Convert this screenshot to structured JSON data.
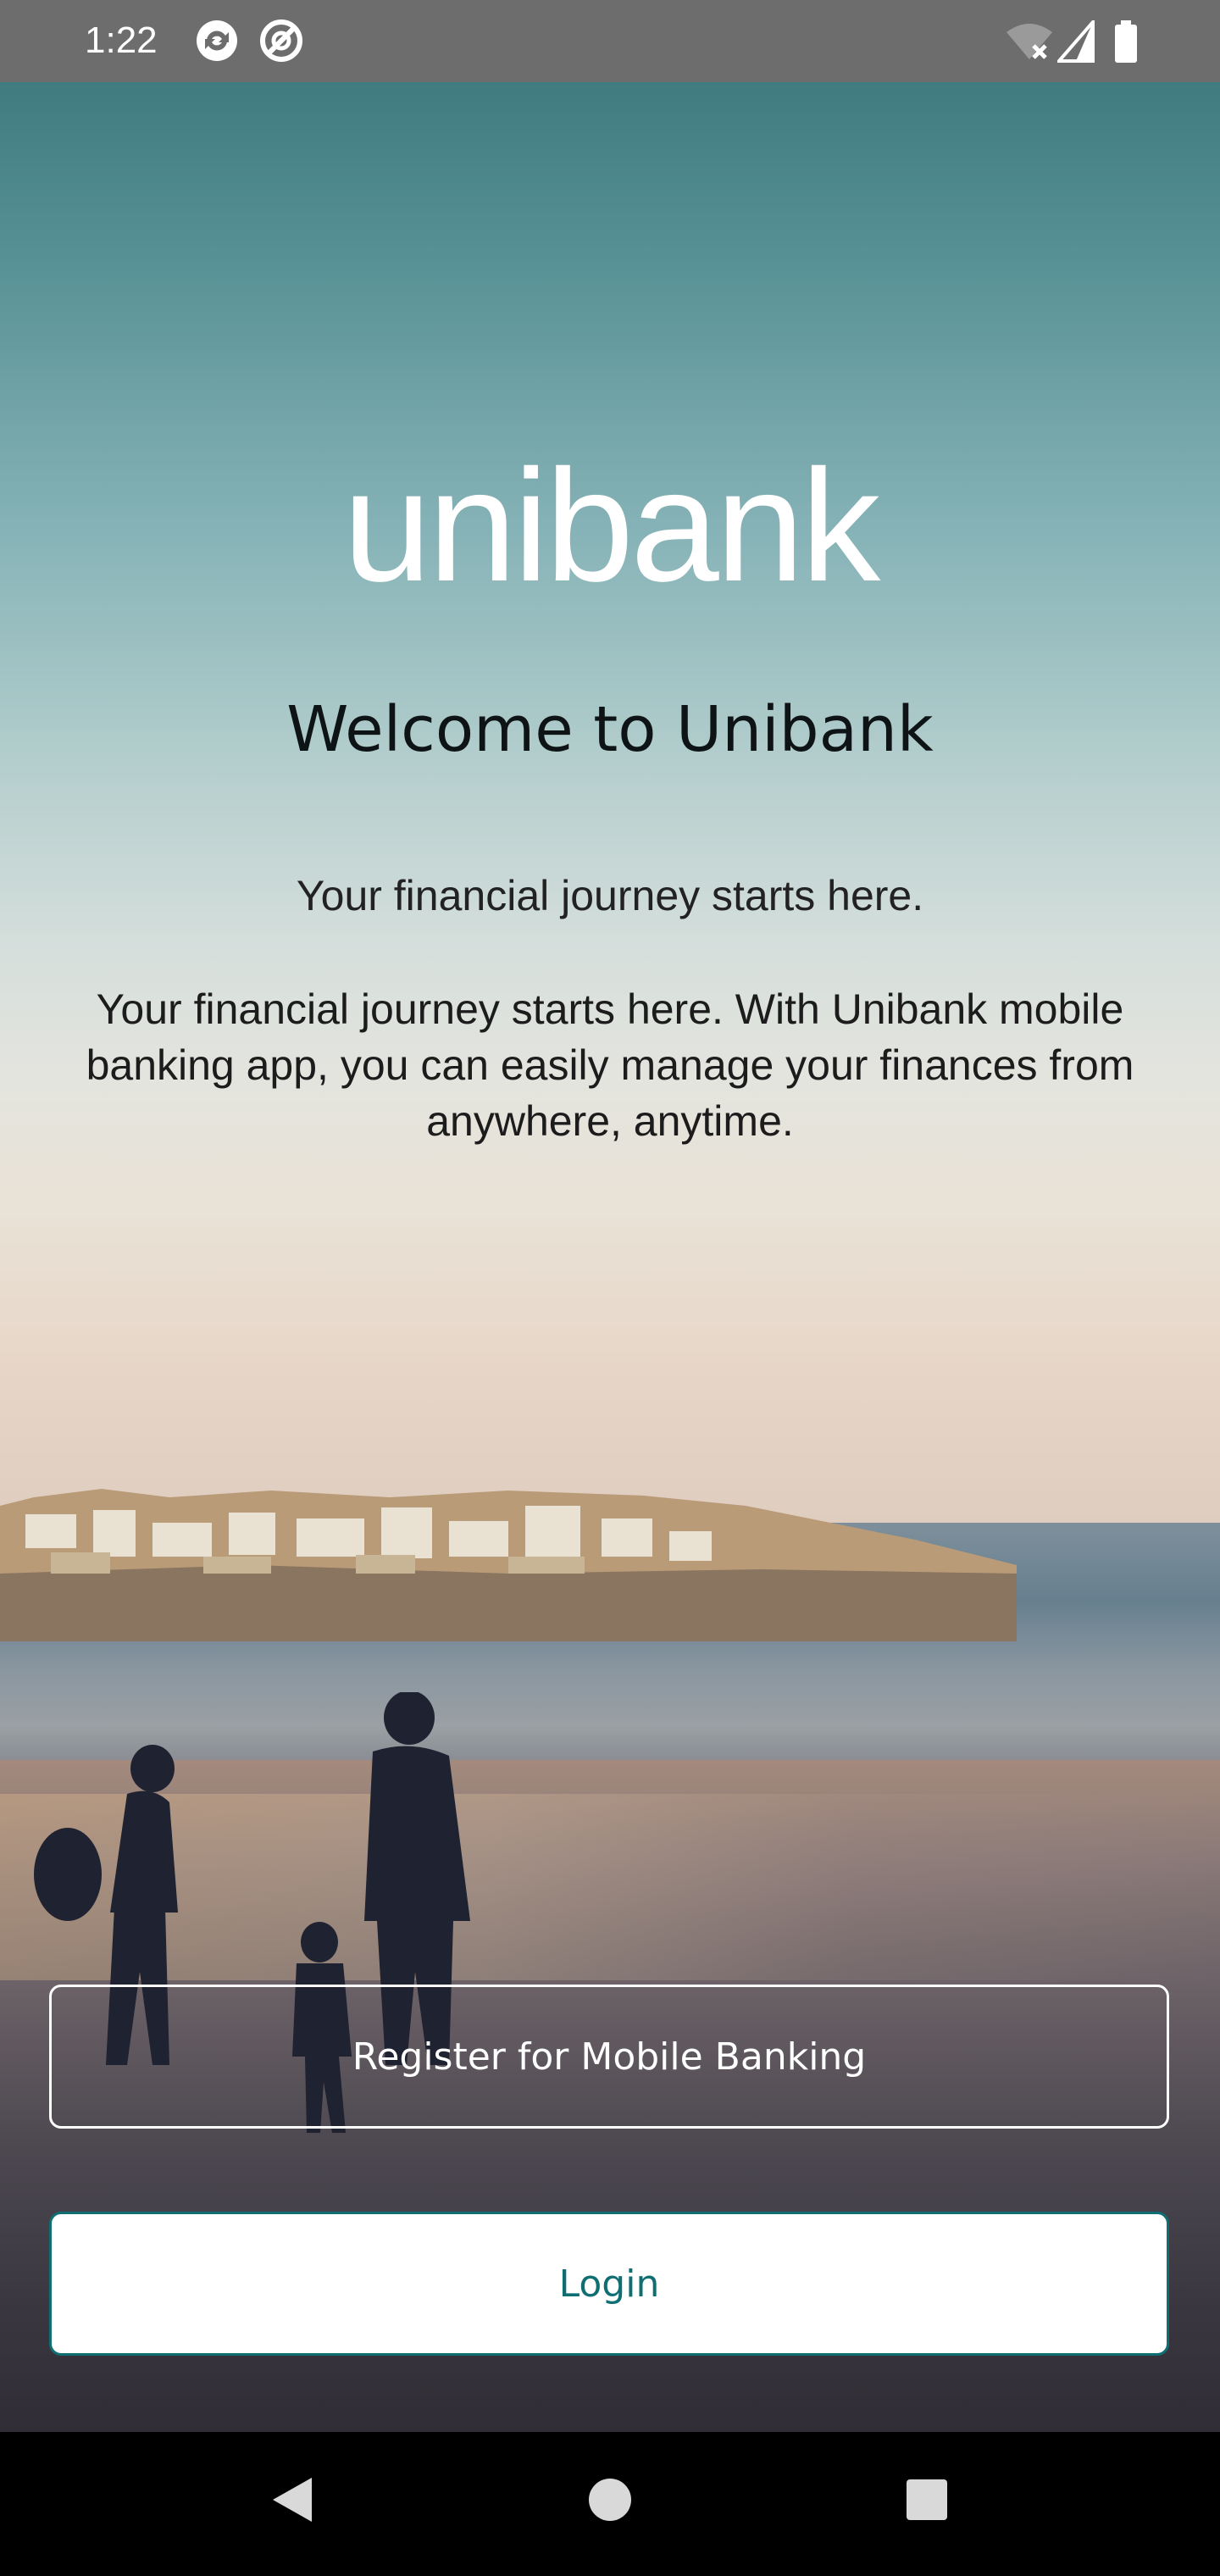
{
  "status_bar": {
    "time": "1:22",
    "left_icons": [
      "sync-icon",
      "do-not-disturb-icon"
    ],
    "right_icons": [
      "wifi-off-icon",
      "signal-icon",
      "battery-icon"
    ]
  },
  "brand": {
    "logo_text": "unibank",
    "accent_color": "#0f6e72"
  },
  "welcome": {
    "title": "Welcome to Unibank",
    "subtitle": "Your financial journey starts here.",
    "description": "Your financial journey starts here. With Unibank mobile banking app, you can easily manage your finances from anywhere, anytime."
  },
  "actions": {
    "register_label": "Register for Mobile Banking",
    "login_label": "Login"
  },
  "nav_bar": {
    "icons": [
      "back-icon",
      "home-icon",
      "recents-icon"
    ]
  }
}
